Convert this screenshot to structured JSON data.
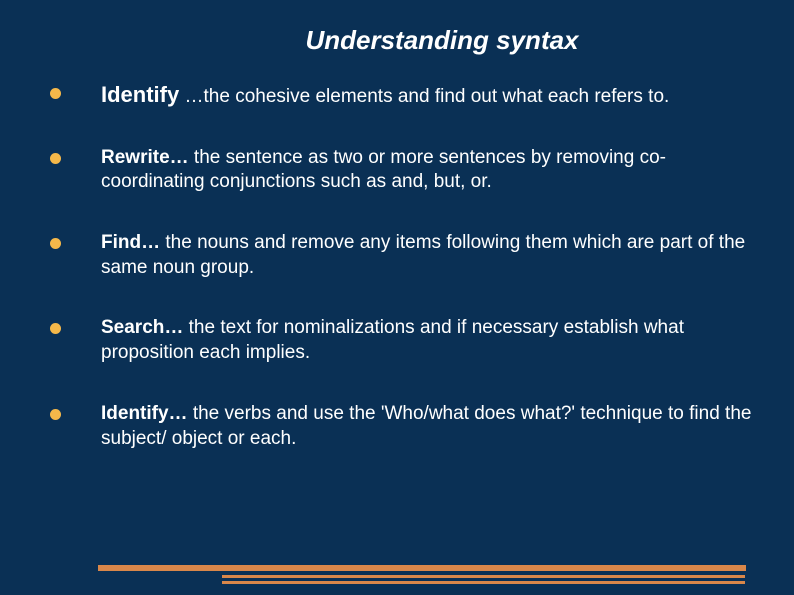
{
  "slide": {
    "title": "Understanding syntax",
    "items": [
      {
        "bold": "Identify",
        "text": " …the cohesive elements and find out what each refers to."
      },
      {
        "bold": "Rewrite…",
        "text": " the sentence as two or more sentences by removing co-coordinating conjunctions such as and, but, or."
      },
      {
        "bold": "Find…",
        "text": " the nouns and remove any items following them which are part of the same noun group."
      },
      {
        "bold": "Search…",
        "text": " the text for nominalizations and if necessary establish what proposition each implies."
      },
      {
        "bold": "Identify…",
        "text": " the verbs and use the 'Who/what does what?' technique to find the subject/ object or each."
      }
    ]
  }
}
